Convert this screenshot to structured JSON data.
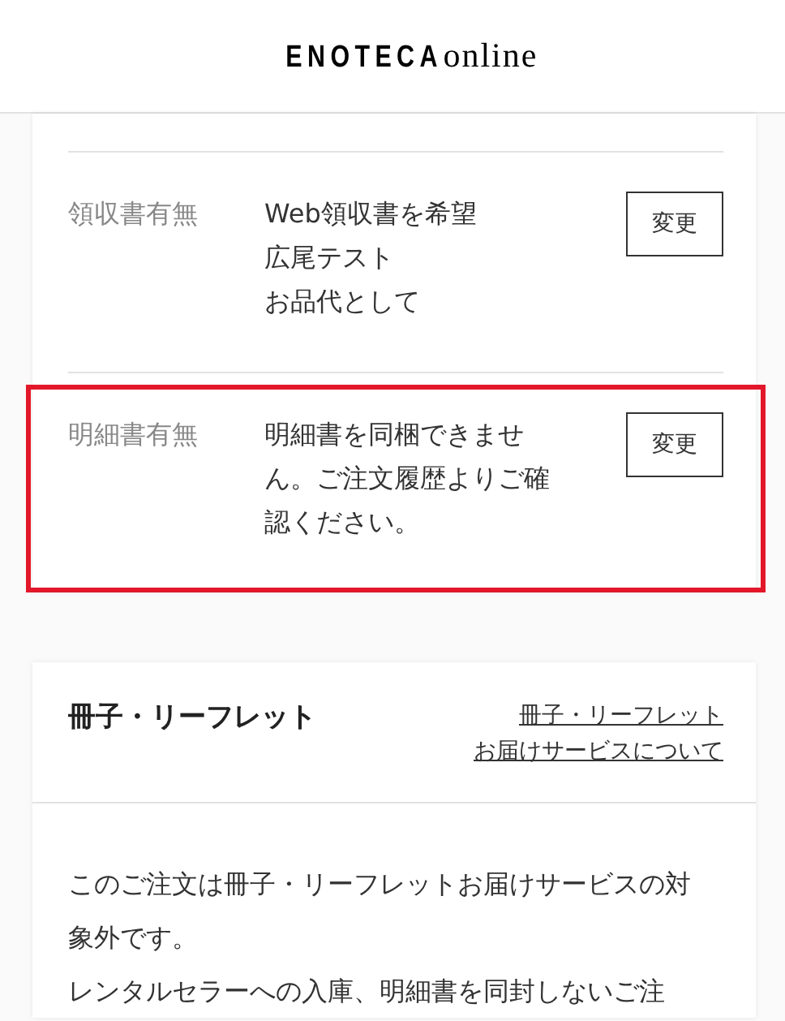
{
  "header": {
    "logo": {
      "brand": "ENOTECA",
      "suffix": "online"
    }
  },
  "details": {
    "rows": [
      {
        "label": "領収書有無",
        "lines": [
          "Web領収書を希望",
          "広尾テスト",
          "お品代として"
        ],
        "button": "変更",
        "highlighted": false
      },
      {
        "label": "明細書有無",
        "lines": [
          "明細書を同梱できません。ご注文履歴よりご確認ください。"
        ],
        "button": "変更",
        "highlighted": true
      }
    ]
  },
  "booklet": {
    "title": "冊子・リーフレット",
    "link_lines": [
      "冊子・リーフレット",
      "お届けサービスについて"
    ],
    "paragraphs": [
      "このご注文は冊子・リーフレットお届けサービスの対象外です。",
      "レンタルセラーへの入庫、明細書を同封しないご注"
    ]
  }
}
